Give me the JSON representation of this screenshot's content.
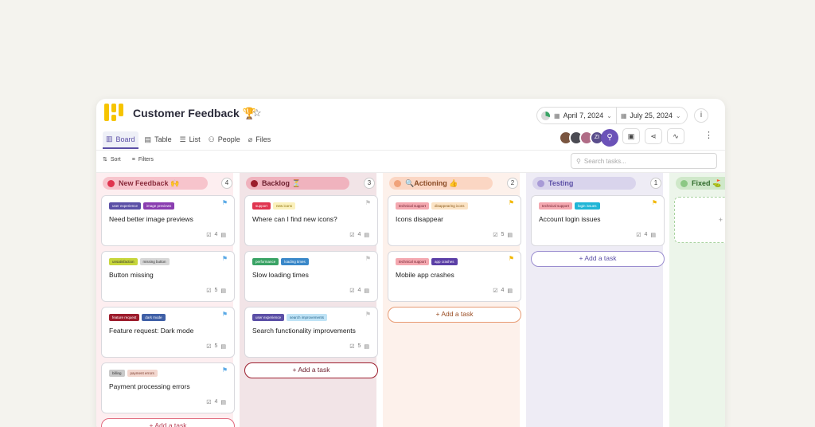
{
  "header": {
    "title": "Customer Feedback",
    "title_emoji": "🏆",
    "start_date": "April 7, 2024",
    "end_date": "July 25, 2024",
    "info_label": "i"
  },
  "tabs": [
    {
      "label": "Board",
      "icon": "board-icon",
      "active": true
    },
    {
      "label": "Table",
      "icon": "table-icon"
    },
    {
      "label": "List",
      "icon": "list-icon"
    },
    {
      "label": "People",
      "icon": "people-icon"
    },
    {
      "label": "Files",
      "icon": "paperclip-icon"
    }
  ],
  "avatars": {
    "initials": "ZI"
  },
  "toolbar": {
    "sort_label": "Sort",
    "filters_label": "Filters",
    "search_placeholder": "Search tasks..."
  },
  "columns": [
    {
      "name": "New Feedback 🙌",
      "count": "4",
      "cards": [
        {
          "tags": [
            "user experience",
            "image previews"
          ],
          "title": "Need better image previews",
          "subtasks": "4"
        },
        {
          "tags": [
            "unsatisfaction",
            "missing button"
          ],
          "title": "Button missing",
          "subtasks": "5"
        },
        {
          "tags": [
            "feature request",
            "dark mode"
          ],
          "title": "Feature request: Dark mode",
          "subtasks": "5"
        },
        {
          "tags": [
            "billing",
            "payment errors"
          ],
          "title": "Payment processing errors",
          "subtasks": "4"
        }
      ],
      "add_label": "+ Add a task"
    },
    {
      "name": "Backlog ⏳",
      "count": "3",
      "cards": [
        {
          "tags": [
            "support",
            "new icons"
          ],
          "title": "Where can I find new icons?",
          "subtasks": "4"
        },
        {
          "tags": [
            "performance",
            "loading times"
          ],
          "title": "Slow loading times",
          "subtasks": "4"
        },
        {
          "tags": [
            "user experience",
            "search improvements"
          ],
          "title": "Search functionality improvements",
          "subtasks": "5"
        }
      ],
      "add_label": "+ Add a task"
    },
    {
      "name": "🔍Actioning 👍",
      "count": "2",
      "cards": [
        {
          "tags": [
            "technical support",
            "disappearing icons"
          ],
          "title": "Icons disappear",
          "subtasks": "5"
        },
        {
          "tags": [
            "technical support",
            "app crashes"
          ],
          "title": "Mobile app crashes",
          "subtasks": "4"
        }
      ],
      "add_label": "+ Add a task"
    },
    {
      "name": "Testing",
      "count": "1",
      "cards": [
        {
          "tags": [
            "technical support",
            "login issues"
          ],
          "title": "Account login issues",
          "subtasks": "4"
        }
      ],
      "add_label": "+ Add a task"
    },
    {
      "name": "Fixed ⛳",
      "count": "",
      "cards": [],
      "add_label": "+"
    }
  ]
}
